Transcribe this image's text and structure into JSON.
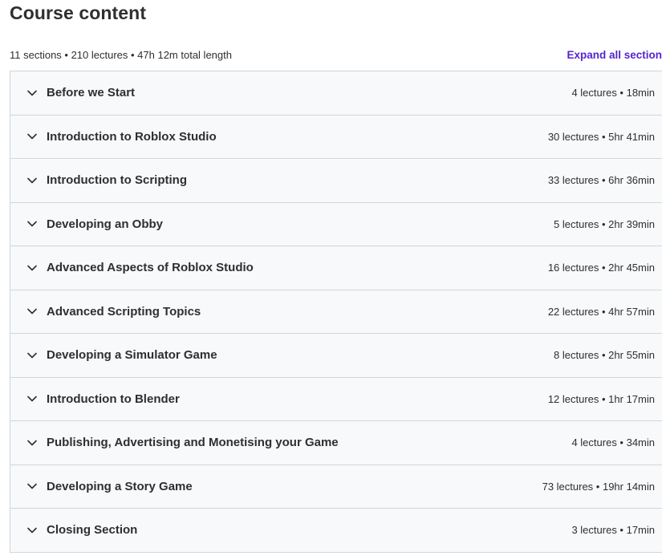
{
  "header": {
    "title": "Course content",
    "summary": "11 sections • 210 lectures • 47h 12m total length",
    "expand_all_label": "Expand all section"
  },
  "sections": [
    {
      "title": "Before we Start",
      "meta": "4 lectures • 18min"
    },
    {
      "title": "Introduction to Roblox Studio",
      "meta": "30 lectures • 5hr 41min"
    },
    {
      "title": "Introduction to Scripting",
      "meta": "33 lectures • 6hr 36min"
    },
    {
      "title": "Developing an Obby",
      "meta": "5 lectures • 2hr 39min"
    },
    {
      "title": "Advanced Aspects of Roblox Studio",
      "meta": "16 lectures • 2hr 45min"
    },
    {
      "title": "Advanced Scripting Topics",
      "meta": "22 lectures • 4hr 57min"
    },
    {
      "title": "Developing a Simulator Game",
      "meta": "8 lectures • 2hr 55min"
    },
    {
      "title": "Introduction to Blender",
      "meta": "12 lectures • 1hr 17min"
    },
    {
      "title": "Publishing, Advertising and Monetising your Game",
      "meta": "4 lectures • 34min"
    },
    {
      "title": "Developing a Story Game",
      "meta": "73 lectures • 19hr 14min"
    },
    {
      "title": "Closing Section",
      "meta": "3 lectures • 17min"
    }
  ],
  "icons": {
    "section_toggle": "chevron-down-icon"
  },
  "colors": {
    "accent": "#5624d0",
    "section_bg": "#f7f9fa",
    "border": "#d1d7dc",
    "text": "#2d2f31"
  }
}
